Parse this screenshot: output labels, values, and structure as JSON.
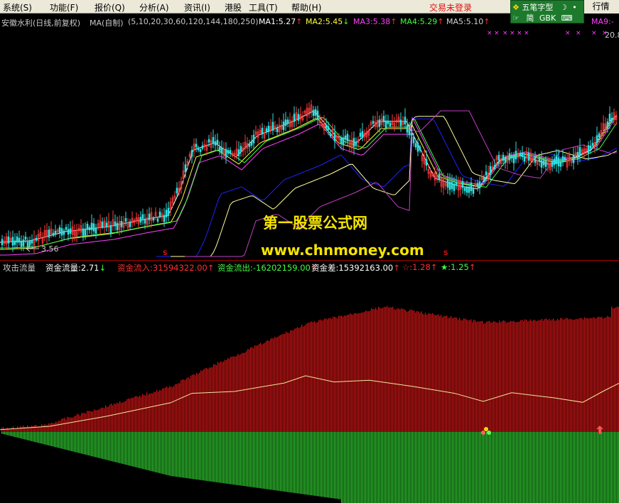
{
  "menu": {
    "items": [
      "系统(S)",
      "功能(F)",
      "报价(Q)",
      "分析(A)",
      "资讯(I)",
      "港股",
      "工具(T)",
      "帮助(H)"
    ],
    "trade_status": "交易未登录",
    "window_button": "行情"
  },
  "ime": {
    "name": "五笔字型",
    "mode": "简",
    "encoding": "GBK"
  },
  "price_header": {
    "stock": "安徽水利(日线,前复权)",
    "indicator": "MA(自制)",
    "params": "(5,10,20,30,60,120,144,180,250)",
    "ma_values": [
      {
        "label": "MA1:5.27",
        "arrow": "↑",
        "color": "#ffffff",
        "arrow_color": "#ff3030"
      },
      {
        "label": "MA2:5.45",
        "arrow": "↓",
        "color": "#ffff40",
        "arrow_color": "#40ff40"
      },
      {
        "label": "MA3:5.38",
        "arrow": "↑",
        "color": "#ff40ff",
        "arrow_color": "#ff3030"
      },
      {
        "label": "MA4:5.29",
        "arrow": "↑",
        "color": "#40ff40",
        "arrow_color": "#ff3030"
      },
      {
        "label": "MA5:5.10",
        "arrow": "↑",
        "color": "#d0d0d0",
        "arrow_color": "#ff3030"
      }
    ],
    "ma9_label": "MA9:-",
    "top_price": "20.8",
    "low_price": "3.56"
  },
  "watermark": {
    "line1": "第一股票公式网",
    "line2": "www.chnmoney.com"
  },
  "indicator_header": {
    "name": "攻击流量",
    "fields": [
      {
        "text": "资金流量:2.71",
        "arrow": "↓",
        "color": "#ffffff",
        "arrow_color": "#40ff40"
      },
      {
        "text": "资金流入:31594322.00",
        "arrow": "↑",
        "color": "#ff3030",
        "arrow_color": "#ff3030"
      },
      {
        "text": "资金流出:-16202159.00",
        "arrow": "↑",
        "color": "#40ff40",
        "arrow_color": "#ff3030"
      },
      {
        "text": "资金差:15392163.00",
        "arrow": "↑",
        "color": "#ffffff",
        "arrow_color": "#ff3030"
      },
      {
        "text": "☆:1.28",
        "arrow": "↑",
        "color": "#ff3030",
        "arrow_color": "#ff3030"
      },
      {
        "text": "★:1.25",
        "arrow": "↑",
        "color": "#40ff40",
        "arrow_color": "#ff3030"
      }
    ]
  },
  "colors": {
    "inflow": "#c81414",
    "outflow": "#2ec42e",
    "flow_line": "#f0e6a0",
    "menu_bg": "#ece9d8"
  }
}
